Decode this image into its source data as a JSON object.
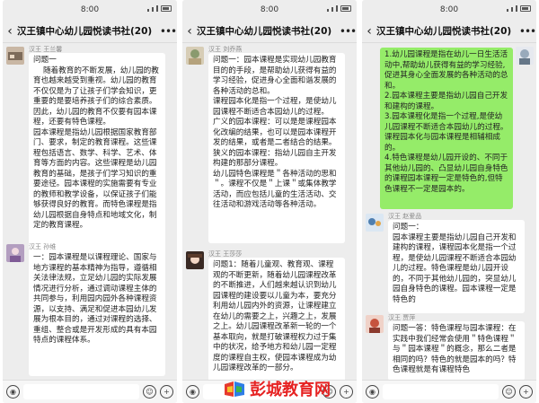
{
  "status_time": "8:00",
  "group_title": "汉王镇中心幼儿园悦读书社(20)",
  "panels": [
    {
      "messages": [
        {
          "sender": "汉王 王兰馨",
          "text": "问题一\n    随着教育的不断发展，幼儿园的教育也越来越受到重视。幼儿园的教育不仅仅是为了让孩子们学会知识，更重要的是要培养孩子们的综合素质。因此，幼儿园的教育不仅要有园本课程，还要有特色课程。\n园本课程是指幼儿园根据国家教育部门、要求，制定的教育课程。这些课程包括语言、数学、科学、艺术、体育等方面的内容。这些课程是幼儿园教育的基础，是孩子们学习知识的重要途径。园本课程的实施需要有专业的教师和教学设备，以保证孩子们能够获得良好的教育。而特色课程是指幼儿园根据自身特点和地域文化，制定的教育课程。"
        },
        {
          "sender": "汉王 孙维",
          "text": "一：园本课程是以课程理论、国家与地方课程的基本精神为指导，遵循相关法律法规，立足幼儿园的实际发展情况进行分析，通过调动课程主体的共同参与，利用园内园外各种课程资源，以支持、满足和促进本园幼儿发展为根本目的，通过对课程的选择、重组、整合或是开发形成的具有本园特点的课程体系。"
        }
      ]
    },
    {
      "messages": [
        {
          "sender": "汉王 刘乔燕",
          "text": "问题一：园本课程是实现幼儿园教育目的的手段，是帮助幼儿获得有益的学习经验，促进身心全面和谐发展的各种活动的总和。\n课程园本化是指一个过程，是使幼儿园课程不断适合本园幼儿的过程。\n广义的园本课程：可以是是课程园本化改编的结果，也可以是园本课程开发的结果，或者是二者结合的结果。\n狭义的园本课程：指幼儿园自主开发构建的那部分课程。\n幼儿园特色课程是＂各种活动的思和＂。课程不仅是＂上课＂或集体教学活动，而应包括儿童的生活活动、交往活动和游戏活动等各种活动。"
        },
        {
          "sender": "汉王 王莎莎",
          "text": "问题1：随着儿童观、教育观、课程观的不断更新，随着幼儿园课程改革的不断推进，人们越来越认识到幼儿园课程的建设要以儿童为本，要充分利用幼儿园内外的资源，让课程建立在幼儿的需要之上，兴趣之上，发展之上。幼儿园课程改革新一轮的一个基本取向，就是打破课程权力过于集中的状况，给予地方和幼儿园一定程度的课程自主权，使园本课程成为幼儿园课程改革的一部分。"
        }
      ]
    },
    {
      "messages": [
        {
          "sender": "",
          "text": "1.幼儿园课程是指在幼儿一日生活活动中,帮助幼儿获得有益的学习经验,促进其身心全面发展的各种活动的总和。\n2.园本课程主要是指幼儿园自己开发和建构的课程。\n3.园本课程化是指一个过程,是使幼儿园课程不断适合本园幼儿的过程。\n课程园本化与园本课程是相辅相成的。\n4.特色课程是幼儿园开设的、不同于其他幼儿园的、凸显幼儿园自身特色的课程园本课程一定是特色的,但特色课程不一定是园本的。"
        },
        {
          "sender": "汉王 赵爱品",
          "text": "问题一：\n园本课程主要是指幼儿园自己开发和建构的课程，课程园本化是指一个过程，是使幼儿园课程不断适合本园幼儿的过程。特色课程是幼儿园开设的，不同于其他幼儿园的，突显幼儿园自身特色的课程。园本课程一定是特色的"
        },
        {
          "sender": "汉王 贾萍",
          "text": "问题一答：特色课程与园本课程：在实践中我们经常会使用＂特色课程＂与＂园本课程＂的概念，那么二者是相同的吗？特色的就是园本的吗？特色课程就是有课程特色"
        }
      ]
    }
  ],
  "watermark": "彭城教育网",
  "colors": {
    "chat_bg": "#ededed",
    "my_bubble": "#95ec69",
    "other_bubble": "#ffffff",
    "watermark": "#e62222"
  },
  "icons": [
    "back-arrow-icon",
    "more-icon",
    "voice-icon",
    "emoji-icon",
    "plus-icon",
    "signal-icon",
    "battery-icon",
    "book-logo-icon"
  ]
}
